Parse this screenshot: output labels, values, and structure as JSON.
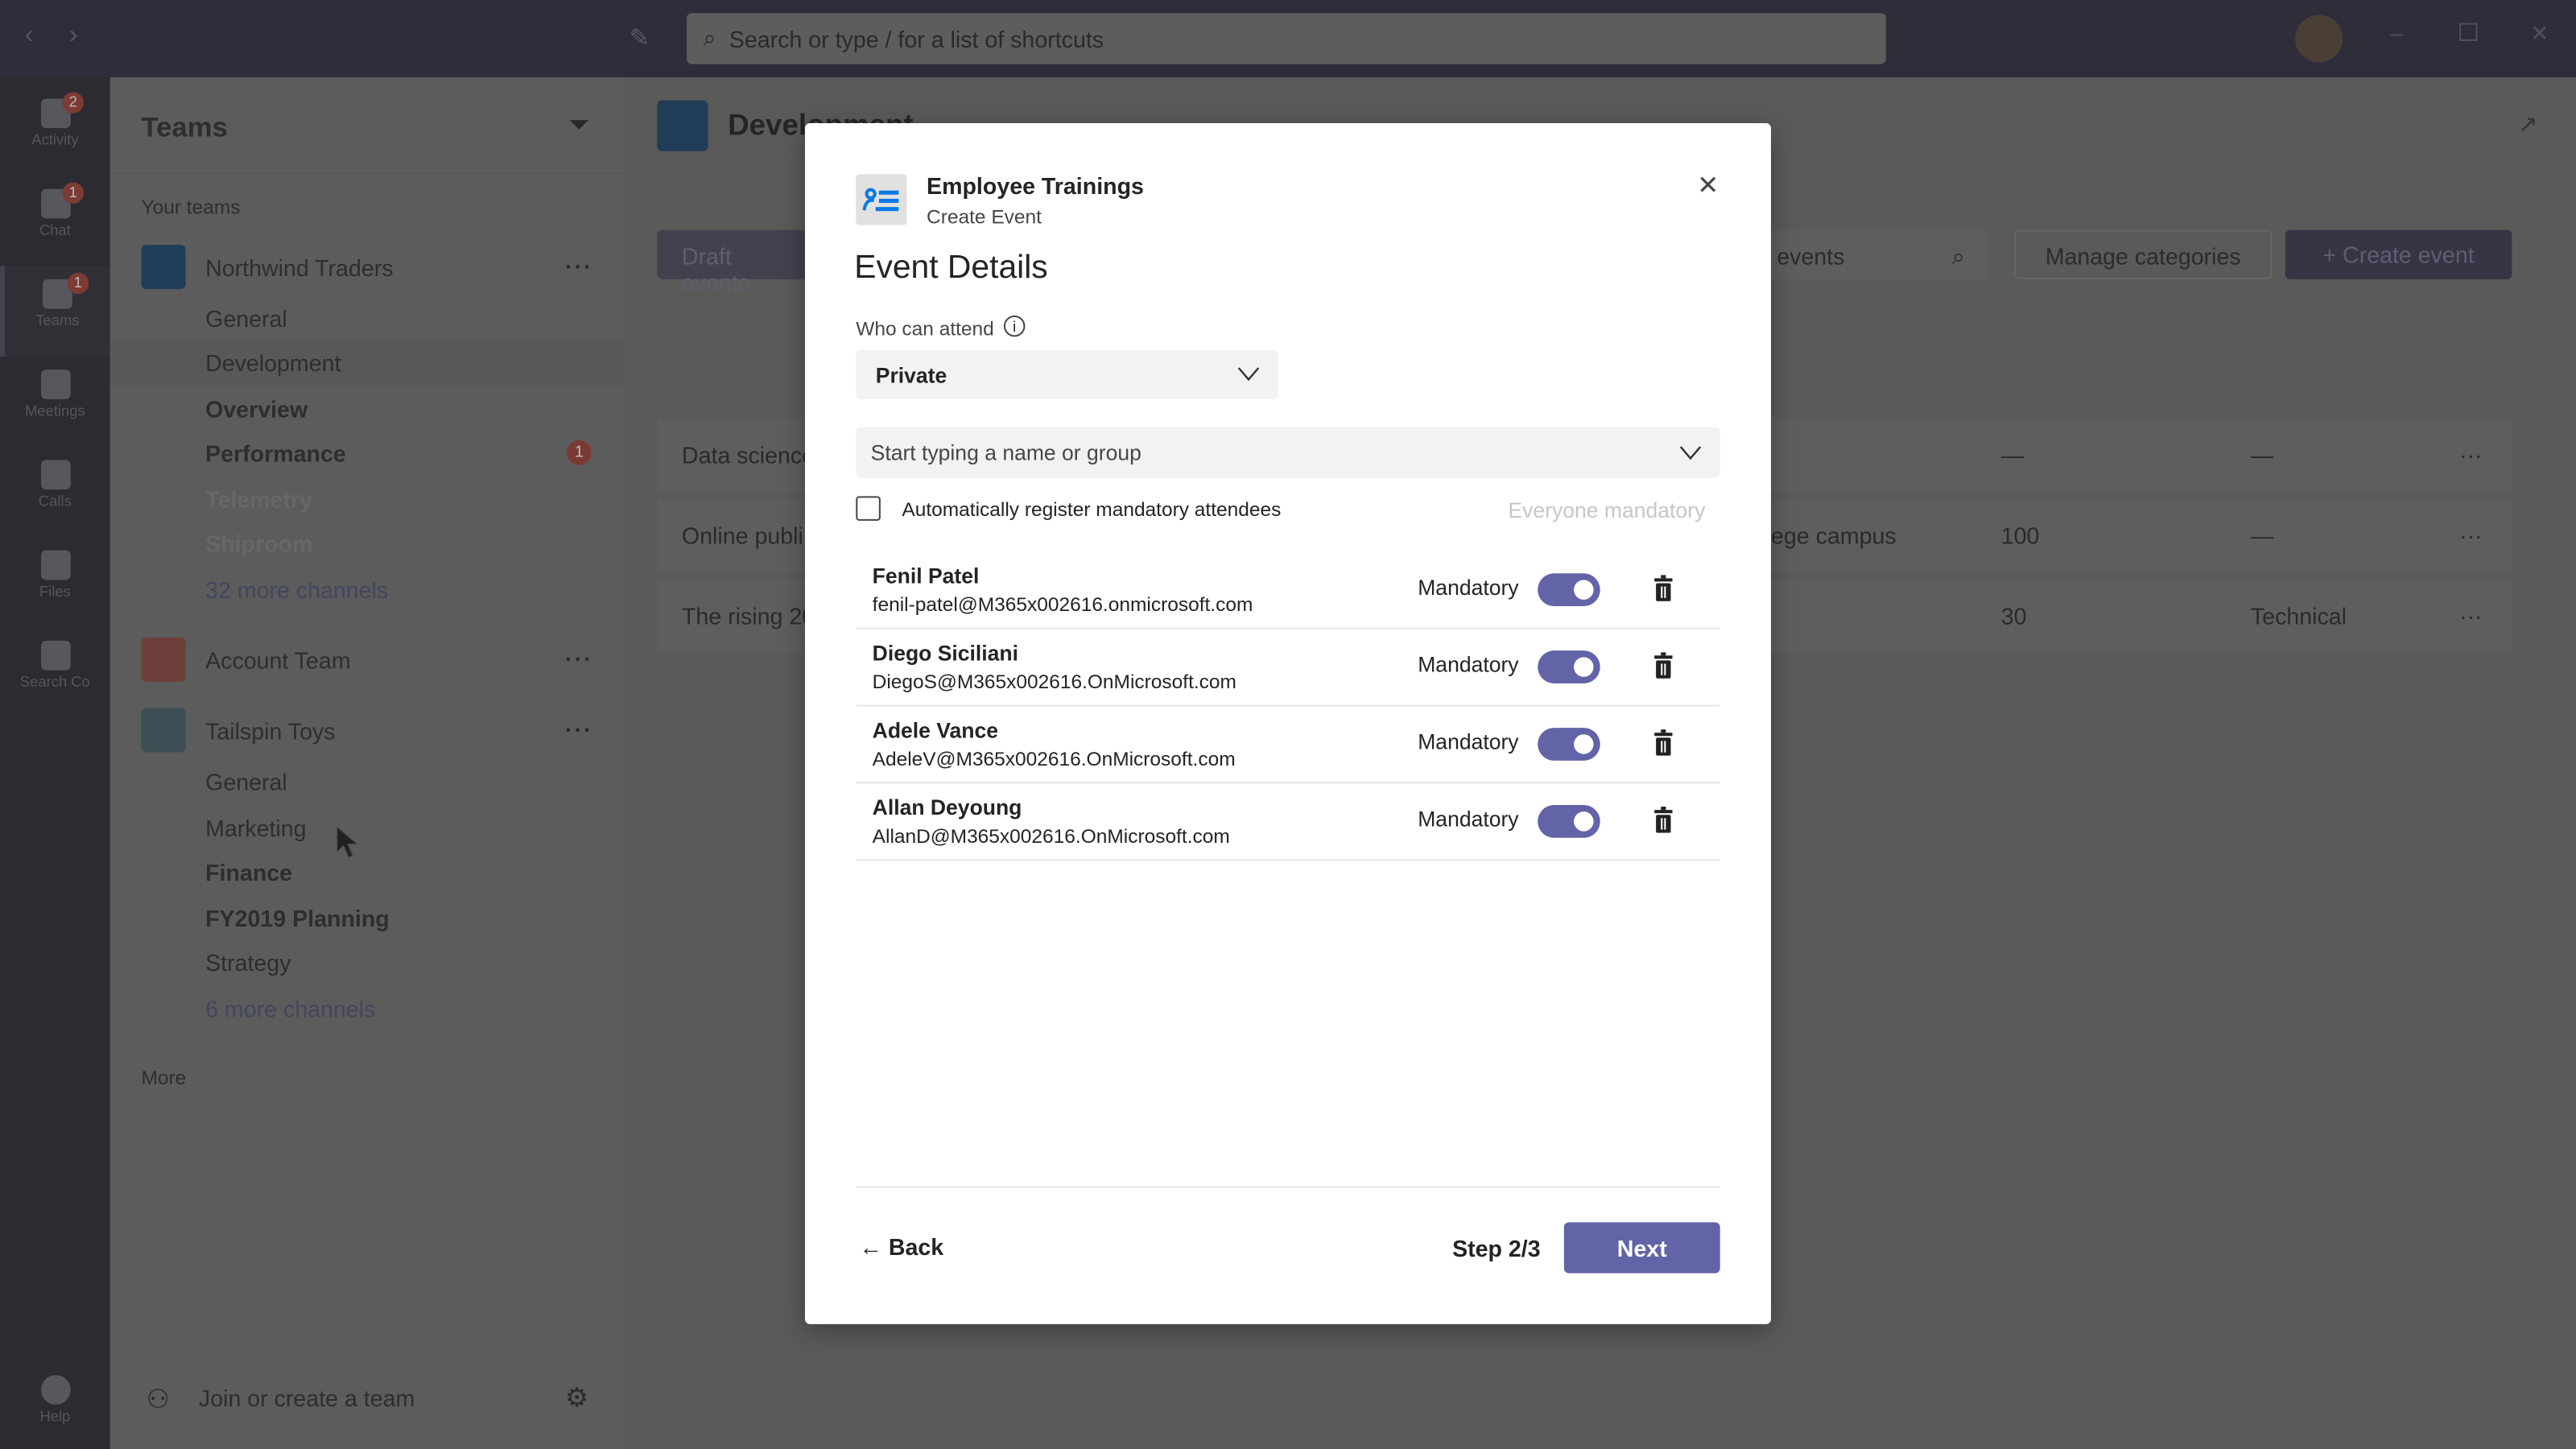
{
  "topbar": {
    "search_placeholder": "Search or type / for a list of shortcuts"
  },
  "rail": [
    {
      "label": "Activity",
      "badge": "2"
    },
    {
      "label": "Chat",
      "badge": "1"
    },
    {
      "label": "Teams",
      "badge": "1"
    },
    {
      "label": "Meetings"
    },
    {
      "label": "Calls"
    },
    {
      "label": "Files"
    },
    {
      "label": "Search Co"
    },
    {
      "label": "Help"
    }
  ],
  "sidebar": {
    "title": "Teams",
    "section": "Your teams",
    "teams": [
      {
        "name": "Northwind Traders",
        "channels": [
          "General",
          "Development",
          "Overview",
          "Performance",
          "Telemetry",
          "Shiproom",
          "32 more channels"
        ],
        "badge": "1"
      },
      {
        "name": "Account Team"
      },
      {
        "name": "Tailspin Toys",
        "channels": [
          "General",
          "Marketing",
          "Finance",
          "FY2019 Planning",
          "Strategy",
          "6 more channels"
        ]
      }
    ],
    "more": "More",
    "join": "Join or create a team"
  },
  "main": {
    "title": "Development",
    "draft_tab": "Draft events",
    "search_partial": "r events",
    "manage": "Manage categories",
    "create": "+ Create event",
    "rows": [
      [
        "Data science",
        "—",
        "—"
      ],
      [
        "Online publi",
        "ege campus",
        "100",
        "—"
      ],
      [
        "The rising 20",
        "30",
        "Technical"
      ]
    ]
  },
  "modal": {
    "app": "Employee Trainings",
    "subtitle": "Create Event",
    "heading": "Event Details",
    "who_label": "Who can attend",
    "who_value": "Private",
    "people_placeholder": "Start typing a name or group",
    "auto_register": "Automatically register mandatory attendees",
    "auto_register_checked": false,
    "everyone": "Everyone mandatory",
    "attendees": [
      {
        "name": "Fenil Patel",
        "email": "fenil-patel@M365x002616.onmicrosoft.com",
        "label": "Mandatory",
        "mandatory": true
      },
      {
        "name": "Diego Siciliani",
        "email": "DiegoS@M365x002616.OnMicrosoft.com",
        "label": "Mandatory",
        "mandatory": true
      },
      {
        "name": "Adele Vance",
        "email": "AdeleV@M365x002616.OnMicrosoft.com",
        "label": "Mandatory",
        "mandatory": true
      },
      {
        "name": "Allan Deyoung",
        "email": "AllanD@M365x002616.OnMicrosoft.com",
        "label": "Mandatory",
        "mandatory": true
      }
    ],
    "back": "Back",
    "step": "Step 2/3",
    "next": "Next",
    "accent": "#6264a7"
  }
}
